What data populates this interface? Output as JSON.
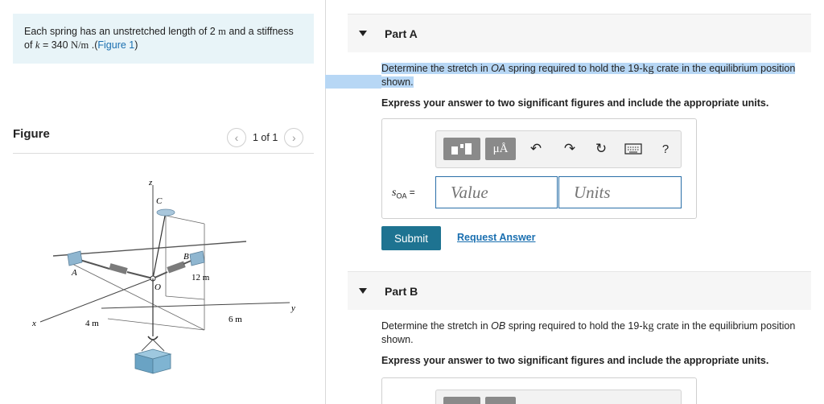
{
  "problem": {
    "text_before_k": "Each spring has an unstretched length of 2 ",
    "length_unit": "m",
    "text_mid": " and a stiffness of ",
    "k_symbol": "k",
    "k_eq": " = 340 ",
    "k_unit": "N/m",
    "figure_link_prefix": " .(",
    "figure_link": "Figure 1",
    "figure_link_suffix": ")"
  },
  "figure": {
    "title": "Figure",
    "pager_text": "1 of 1",
    "prev_icon": "chevron-left-icon",
    "next_icon": "chevron-right-icon",
    "labels": {
      "z": "z",
      "c": "C",
      "b": "B",
      "a": "A",
      "o": "O",
      "x": "x",
      "y": "y",
      "dim_12m": "12 m",
      "dim_4m": "4 m",
      "dim_6m": "6 m"
    }
  },
  "partA": {
    "title": "Part A",
    "q_prefix": "Determine the stretch in ",
    "q_spring": "OA",
    "q_mid": " spring required to hold the 19-",
    "q_unit": "kg",
    "q_suffix": " crate in the equilibrium position shown.",
    "instruction": "Express your answer to two significant figures and include the appropriate units.",
    "var_symbol": "s",
    "var_sub": "OA",
    "var_eq": " =",
    "value_placeholder": "Value",
    "units_placeholder": "Units",
    "mu_label": "μÅ",
    "submit": "Submit",
    "request": "Request Answer",
    "toolbar_icons": [
      "templates-icon",
      "mu-angstrom-icon",
      "undo-icon",
      "redo-icon",
      "reset-icon",
      "keyboard-icon",
      "help-icon"
    ],
    "help_label": "?"
  },
  "partB": {
    "title": "Part B",
    "q_prefix": "Determine the stretch in ",
    "q_spring": "OB",
    "q_mid": " spring required to hold the 19-",
    "q_unit": "kg",
    "q_suffix": " crate in the equilibrium position shown.",
    "instruction": "Express your answer to two significant figures and include the appropriate units."
  },
  "colors": {
    "prompt_bg": "#e8f4f8",
    "link": "#1a6fb0",
    "submit_bg": "#1e7391",
    "highlight": "#b7d7f5"
  }
}
